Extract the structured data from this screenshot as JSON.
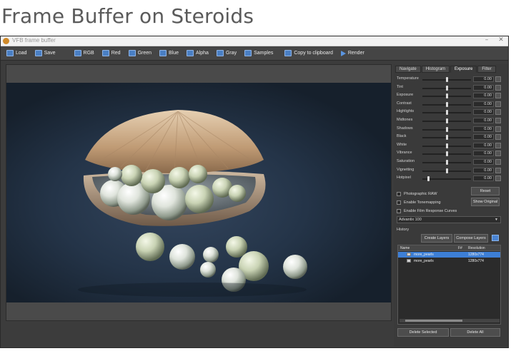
{
  "page_heading": "Frame Buffer on Steroids",
  "window": {
    "title": "VFB frame buffer",
    "buttons": [
      "–",
      "✕"
    ]
  },
  "toolbar": [
    {
      "label": "Load",
      "icon": "folder-icon"
    },
    {
      "label": "Save",
      "icon": "floppy-icon"
    },
    {
      "label": "RGB",
      "icon": "rgb-channel-icon"
    },
    {
      "label": "Red",
      "icon": "red-channel-icon"
    },
    {
      "label": "Green",
      "icon": "green-channel-icon"
    },
    {
      "label": "Blue",
      "icon": "blue-channel-icon"
    },
    {
      "label": "Alpha",
      "icon": "alpha-channel-icon"
    },
    {
      "label": "Gray",
      "icon": "gray-channel-icon"
    },
    {
      "label": "Samples",
      "icon": "samples-icon"
    },
    {
      "label": "Copy to clipboard",
      "icon": "clipboard-icon"
    },
    {
      "label": "Render",
      "icon": "play-icon"
    }
  ],
  "panel": {
    "tabs": [
      {
        "label": "Navigate",
        "active": false
      },
      {
        "label": "Histogram",
        "active": false
      },
      {
        "label": "Exposure",
        "active": true
      },
      {
        "label": "Filter",
        "active": false
      }
    ],
    "sliders": [
      {
        "label": "Temperature",
        "value": "0.00",
        "position": 0.5
      },
      {
        "label": "Tint",
        "value": "0.00",
        "position": 0.5
      },
      {
        "label": "Exposure",
        "value": "0.00",
        "position": 0.5
      },
      {
        "label": "Contrast",
        "value": "0.00",
        "position": 0.5
      },
      {
        "label": "Highlights",
        "value": "0.00",
        "position": 0.5
      },
      {
        "label": "Midtones",
        "value": "0.00",
        "position": 0.5
      },
      {
        "label": "Shadows",
        "value": "0.00",
        "position": 0.5
      },
      {
        "label": "Black",
        "value": "0.00",
        "position": 0.5
      },
      {
        "label": "White",
        "value": "0.00",
        "position": 0.5
      },
      {
        "label": "Vibrance",
        "value": "0.00",
        "position": 0.5
      },
      {
        "label": "Saturation",
        "value": "0.00",
        "position": 0.5
      },
      {
        "label": "Vignetting",
        "value": "0.00",
        "position": 0.5
      },
      {
        "label": "Hotpixel",
        "value": "0.00",
        "position": 0.12
      }
    ],
    "reset_label": "Reset",
    "show_original_label": "Show Original",
    "checkboxes": [
      {
        "label": "Photographic RAW",
        "checked": false
      },
      {
        "label": "Enable Tonemapping",
        "checked": false
      },
      {
        "label": "Enable Film Response Curves",
        "checked": false
      }
    ],
    "film_preset": "Advantix 100",
    "history_label": "History",
    "create_layers_label": "Create Layers",
    "compose_layers_label": "Compose Layers",
    "history_columns": [
      "Name",
      "F#",
      "Resolution"
    ],
    "history_rows": [
      {
        "name": "more_pearls",
        "frame": "",
        "resolution": "1280x774",
        "selected": true
      },
      {
        "name": "more_pearls",
        "frame": "",
        "resolution": "1280x774",
        "selected": false
      }
    ],
    "delete_selected_label": "Delete Selected",
    "delete_all_label": "Delete All"
  },
  "colors": {
    "accent": "#3d7fd6",
    "window_bg": "#3c3c3c",
    "heading": "#5a5a5a"
  }
}
